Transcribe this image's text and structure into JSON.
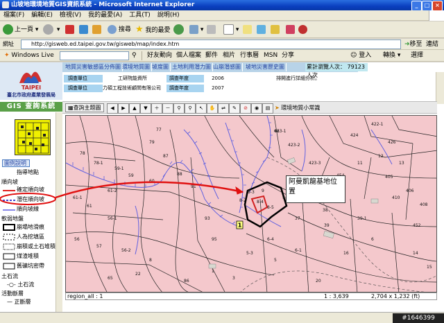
{
  "window": {
    "title": "山坡地環境地質GIS資訊系統 - Microsoft Internet Explorer"
  },
  "menu": [
    "檔案(F)",
    "編輯(E)",
    "檢視(V)",
    "我的最愛(A)",
    "工具(T)",
    "說明(H)"
  ],
  "toolbar": {
    "back": "上一頁",
    "search": "搜尋",
    "favorites": "我的最愛"
  },
  "address": {
    "url": "http://gisweb.ed.taipei.gov.tw/gisweb/map/index.htm",
    "go": "移至",
    "links": "連結"
  },
  "livebar": {
    "brand": "Windows Live",
    "items": [
      "好友動向",
      "個人檔案",
      "郵件",
      "相片",
      "行事曆",
      "MSN",
      "分享"
    ],
    "signin": "登入",
    "convert": "轉換",
    "select": "選擇"
  },
  "site": {
    "logo_text": "TAIPEI",
    "dept": "臺北市政府產業發展局"
  },
  "tabs": [
    "地質災害敏感區分佈圖",
    "環境地質圖",
    "坡度圖",
    "土地利用潛力圖",
    "山崩潛感圖",
    "坡地災害歷史圖"
  ],
  "visitor": "累計瀏覽人次： 79123 人次",
  "info_rows": [
    {
      "label1": "調查單位",
      "value1": "工研院能資所",
      "label2": "調查年度",
      "value2": "2006"
    },
    {
      "label1": "調查單位",
      "value1": "力碩工程技術顧問有限公司",
      "label2": "調查年度",
      "value2": "2007"
    }
  ],
  "side_text": "排開進行詳細分析。",
  "gis": {
    "header": "GIS 查詢系統",
    "query_button": "查詢主題圖",
    "layer_select": "環境地質小常識"
  },
  "legend": {
    "tab": "圖例說明",
    "items": [
      {
        "label": "指導地點",
        "type": "text"
      },
      {
        "label": "順向坡",
        "type": "heading"
      },
      {
        "label": "確定順向坡",
        "type": "line-red"
      },
      {
        "label": "潛在順向坡",
        "type": "line-blue-dash"
      },
      {
        "label": "順向坡線",
        "type": "line-blue"
      },
      {
        "label": "軟弱地盤",
        "type": "heading"
      },
      {
        "label": "崩塌地滑痕",
        "type": "box-solid"
      },
      {
        "label": "人為挖填區",
        "type": "box-dash"
      },
      {
        "label": "崩積或土石堆積",
        "type": "box-dot"
      },
      {
        "label": "煤渣堆積",
        "type": "box-thin"
      },
      {
        "label": "舊礦坑密帶",
        "type": "box-thin"
      },
      {
        "label": "土石流",
        "type": "heading"
      },
      {
        "label": "土石流",
        "type": "icon"
      },
      {
        "label": "活動斷層",
        "type": "heading"
      },
      {
        "label": "正斷層",
        "type": "line-black"
      }
    ]
  },
  "map": {
    "callout": "阿曼凱龍基地位置",
    "marker": "1",
    "parcels": [
      "423-1",
      "423-2",
      "423-3",
      "422-1",
      "424",
      "426",
      "77",
      "79",
      "78",
      "78-1",
      "59-1",
      "59",
      "60",
      "61-2",
      "61-1",
      "61",
      "56-1",
      "56",
      "57",
      "56-2",
      "8",
      "8-2",
      "8-3",
      "8-4",
      "8-5",
      "9",
      "9-1",
      "37",
      "37-1",
      "38",
      "39",
      "39-1",
      "6",
      "6-1",
      "6-4",
      "5",
      "5-3",
      "3",
      "1",
      "86",
      "87",
      "88",
      "91",
      "93",
      "95",
      "405",
      "406",
      "408",
      "410",
      "452",
      "454",
      "11",
      "12",
      "13",
      "14",
      "15",
      "16",
      "20",
      "22",
      "65",
      "66"
    ]
  },
  "status": {
    "layer": "region_all : 1",
    "scale": "1 : 3,639",
    "size": "2,704 x 1,232 (ft)"
  },
  "watermark": "#1646399"
}
